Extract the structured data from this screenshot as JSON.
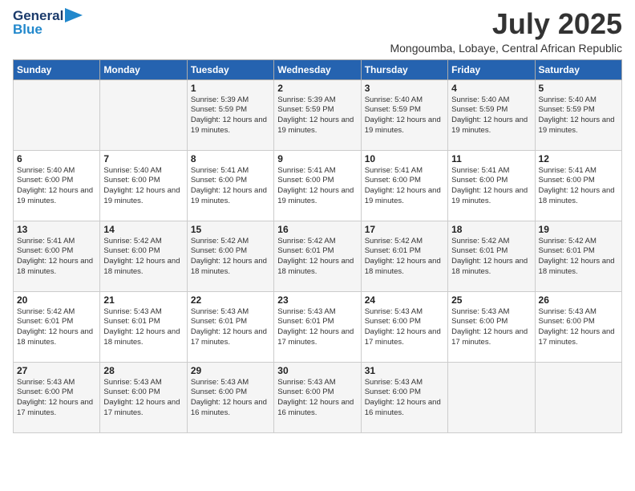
{
  "logo": {
    "line1": "General",
    "line2": "Blue"
  },
  "title": "July 2025",
  "location": "Mongoumba, Lobaye, Central African Republic",
  "weekdays": [
    "Sunday",
    "Monday",
    "Tuesday",
    "Wednesday",
    "Thursday",
    "Friday",
    "Saturday"
  ],
  "weeks": [
    [
      {
        "day": "",
        "info": ""
      },
      {
        "day": "",
        "info": ""
      },
      {
        "day": "1",
        "info": "Sunrise: 5:39 AM\nSunset: 5:59 PM\nDaylight: 12 hours and 19 minutes."
      },
      {
        "day": "2",
        "info": "Sunrise: 5:39 AM\nSunset: 5:59 PM\nDaylight: 12 hours and 19 minutes."
      },
      {
        "day": "3",
        "info": "Sunrise: 5:40 AM\nSunset: 5:59 PM\nDaylight: 12 hours and 19 minutes."
      },
      {
        "day": "4",
        "info": "Sunrise: 5:40 AM\nSunset: 5:59 PM\nDaylight: 12 hours and 19 minutes."
      },
      {
        "day": "5",
        "info": "Sunrise: 5:40 AM\nSunset: 5:59 PM\nDaylight: 12 hours and 19 minutes."
      }
    ],
    [
      {
        "day": "6",
        "info": "Sunrise: 5:40 AM\nSunset: 6:00 PM\nDaylight: 12 hours and 19 minutes."
      },
      {
        "day": "7",
        "info": "Sunrise: 5:40 AM\nSunset: 6:00 PM\nDaylight: 12 hours and 19 minutes."
      },
      {
        "day": "8",
        "info": "Sunrise: 5:41 AM\nSunset: 6:00 PM\nDaylight: 12 hours and 19 minutes."
      },
      {
        "day": "9",
        "info": "Sunrise: 5:41 AM\nSunset: 6:00 PM\nDaylight: 12 hours and 19 minutes."
      },
      {
        "day": "10",
        "info": "Sunrise: 5:41 AM\nSunset: 6:00 PM\nDaylight: 12 hours and 19 minutes."
      },
      {
        "day": "11",
        "info": "Sunrise: 5:41 AM\nSunset: 6:00 PM\nDaylight: 12 hours and 19 minutes."
      },
      {
        "day": "12",
        "info": "Sunrise: 5:41 AM\nSunset: 6:00 PM\nDaylight: 12 hours and 18 minutes."
      }
    ],
    [
      {
        "day": "13",
        "info": "Sunrise: 5:41 AM\nSunset: 6:00 PM\nDaylight: 12 hours and 18 minutes."
      },
      {
        "day": "14",
        "info": "Sunrise: 5:42 AM\nSunset: 6:00 PM\nDaylight: 12 hours and 18 minutes."
      },
      {
        "day": "15",
        "info": "Sunrise: 5:42 AM\nSunset: 6:00 PM\nDaylight: 12 hours and 18 minutes."
      },
      {
        "day": "16",
        "info": "Sunrise: 5:42 AM\nSunset: 6:01 PM\nDaylight: 12 hours and 18 minutes."
      },
      {
        "day": "17",
        "info": "Sunrise: 5:42 AM\nSunset: 6:01 PM\nDaylight: 12 hours and 18 minutes."
      },
      {
        "day": "18",
        "info": "Sunrise: 5:42 AM\nSunset: 6:01 PM\nDaylight: 12 hours and 18 minutes."
      },
      {
        "day": "19",
        "info": "Sunrise: 5:42 AM\nSunset: 6:01 PM\nDaylight: 12 hours and 18 minutes."
      }
    ],
    [
      {
        "day": "20",
        "info": "Sunrise: 5:42 AM\nSunset: 6:01 PM\nDaylight: 12 hours and 18 minutes."
      },
      {
        "day": "21",
        "info": "Sunrise: 5:43 AM\nSunset: 6:01 PM\nDaylight: 12 hours and 18 minutes."
      },
      {
        "day": "22",
        "info": "Sunrise: 5:43 AM\nSunset: 6:01 PM\nDaylight: 12 hours and 17 minutes."
      },
      {
        "day": "23",
        "info": "Sunrise: 5:43 AM\nSunset: 6:01 PM\nDaylight: 12 hours and 17 minutes."
      },
      {
        "day": "24",
        "info": "Sunrise: 5:43 AM\nSunset: 6:00 PM\nDaylight: 12 hours and 17 minutes."
      },
      {
        "day": "25",
        "info": "Sunrise: 5:43 AM\nSunset: 6:00 PM\nDaylight: 12 hours and 17 minutes."
      },
      {
        "day": "26",
        "info": "Sunrise: 5:43 AM\nSunset: 6:00 PM\nDaylight: 12 hours and 17 minutes."
      }
    ],
    [
      {
        "day": "27",
        "info": "Sunrise: 5:43 AM\nSunset: 6:00 PM\nDaylight: 12 hours and 17 minutes."
      },
      {
        "day": "28",
        "info": "Sunrise: 5:43 AM\nSunset: 6:00 PM\nDaylight: 12 hours and 17 minutes."
      },
      {
        "day": "29",
        "info": "Sunrise: 5:43 AM\nSunset: 6:00 PM\nDaylight: 12 hours and 16 minutes."
      },
      {
        "day": "30",
        "info": "Sunrise: 5:43 AM\nSunset: 6:00 PM\nDaylight: 12 hours and 16 minutes."
      },
      {
        "day": "31",
        "info": "Sunrise: 5:43 AM\nSunset: 6:00 PM\nDaylight: 12 hours and 16 minutes."
      },
      {
        "day": "",
        "info": ""
      },
      {
        "day": "",
        "info": ""
      }
    ]
  ]
}
